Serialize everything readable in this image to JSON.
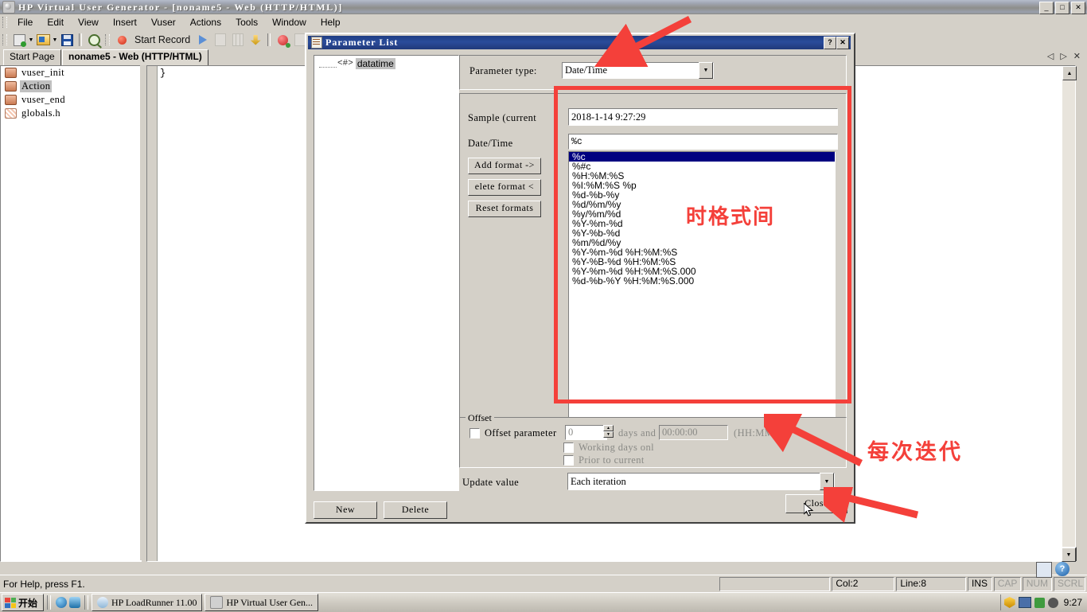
{
  "app": {
    "title": "HP Virtual User Generator - [noname5 - Web (HTTP/HTML)]",
    "window_buttons": {
      "minimize": "_",
      "maximize": "□",
      "close": "✕"
    }
  },
  "menu": {
    "items": [
      "File",
      "Edit",
      "View",
      "Insert",
      "Vuser",
      "Actions",
      "Tools",
      "Window",
      "Help"
    ]
  },
  "toolbar": {
    "start_record_label": "Start Record",
    "icons": [
      "new-script-icon",
      "dropdown-arrow-icon",
      "open-folder-icon",
      "dropdown-arrow-icon",
      "save-icon",
      "find-icon",
      "record-icon",
      "run-icon",
      "stop-icon",
      "pause-icon",
      "download-icon",
      "runtime-settings-icon"
    ]
  },
  "tabs": {
    "items": [
      {
        "label": "Start Page",
        "active": false
      },
      {
        "label": "noname5 - Web (HTTP/HTML)",
        "active": true
      }
    ],
    "nav": [
      "◁",
      "▷",
      "✕"
    ]
  },
  "tree": {
    "items": [
      {
        "label": "vuser_init",
        "icon": "action-icon",
        "selected": false
      },
      {
        "label": "Action",
        "icon": "action-icon",
        "selected": true
      },
      {
        "label": "vuser_end",
        "icon": "action-icon",
        "selected": false
      },
      {
        "label": "globals.h",
        "icon": "header-file-icon",
        "selected": false
      }
    ]
  },
  "editor": {
    "code": "}"
  },
  "statusbar": {
    "help_text": "For Help, press F1.",
    "fields": [
      "",
      "Col:2",
      "Line:8",
      "INS",
      "CAP",
      "NUM",
      "SCRL"
    ],
    "col": "Col:2",
    "line": "Line:8"
  },
  "taskbar": {
    "start_label": "开始",
    "quick_launch": [
      "internet-explorer-icon",
      "show-desktop-icon"
    ],
    "tasks": [
      {
        "label": "HP LoadRunner 11.00",
        "icon": "loadrunner-icon"
      },
      {
        "label": "HP Virtual User Gen...",
        "icon": "vugen-icon"
      }
    ],
    "tray_icons": [
      "shield-icon",
      "network-warning-icon",
      "sync-icon",
      "bug-icon"
    ],
    "clock": "9:27"
  },
  "dialog": {
    "title": "Parameter List",
    "titlebar_buttons": {
      "help": "?",
      "close": "✕"
    },
    "tree": {
      "items": [
        {
          "label": "datatime",
          "marker": "<#>",
          "selected": true
        }
      ]
    },
    "buttons": {
      "new": "New",
      "delete": "Delete",
      "close": "Close"
    },
    "parameter_type": {
      "label": "Parameter type:",
      "value": "Date/Time"
    },
    "sample": {
      "label": "Sample (current",
      "value": "2018-1-14 9:27:29"
    },
    "datetime": {
      "label": "Date/Time",
      "format_value": "%c",
      "buttons": [
        "Add format ->",
        "elete format <",
        "Reset formats"
      ]
    },
    "format_list": [
      {
        "text": "%c",
        "selected": true
      },
      {
        "text": "%#c",
        "selected": false
      },
      {
        "text": "%H:%M:%S",
        "selected": false
      },
      {
        "text": "%I:%M:%S %p",
        "selected": false
      },
      {
        "text": "%d-%b-%y",
        "selected": false
      },
      {
        "text": "%d/%m/%y",
        "selected": false
      },
      {
        "text": "%y/%m/%d",
        "selected": false
      },
      {
        "text": "%Y-%m-%d",
        "selected": false
      },
      {
        "text": "%Y-%b-%d",
        "selected": false
      },
      {
        "text": "%m/%d/%y",
        "selected": false
      },
      {
        "text": "%Y-%m-%d %H:%M:%S",
        "selected": false
      },
      {
        "text": "%Y-%B-%d %H:%M:%S",
        "selected": false
      },
      {
        "text": "%Y-%m-%d %H:%M:%S.000",
        "selected": false
      },
      {
        "text": "%d-%b-%Y %H:%M:%S.000",
        "selected": false
      }
    ],
    "offset": {
      "legend": "Offset",
      "parameter_label": "Offset parameter",
      "days_value": "0",
      "days_label": "days and",
      "time_value": "00:00:00",
      "time_hint": "(HH:MM:SS)",
      "working_days_label": "Working days onl",
      "prior_label": "Prior to current",
      "checked": false
    },
    "update_value": {
      "label": "Update value",
      "value": "Each iteration"
    }
  },
  "annotations": [
    {
      "text": "时格式间",
      "kind": "red-text"
    },
    {
      "text": "每次迭代",
      "kind": "red-text"
    }
  ],
  "colors": {
    "annotation_red": "#f4403a",
    "dialog_title_blue": "#22418c",
    "selection_blue": "#000080",
    "face": "#d4d0c8"
  }
}
